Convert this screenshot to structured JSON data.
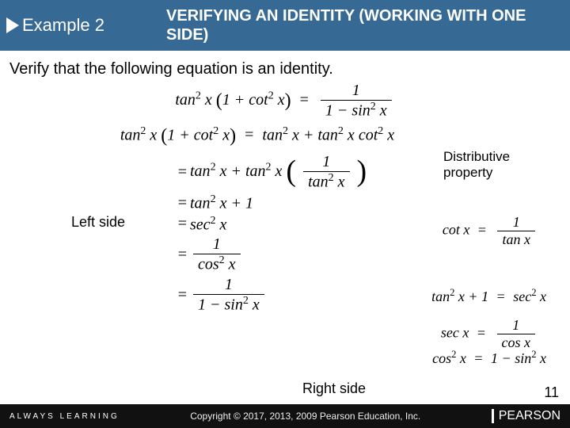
{
  "header": {
    "example_label": "Example 2",
    "title": "VERIFYING AN IDENTITY (WORKING WITH ONE SIDE)"
  },
  "instruction": "Verify that the following equation is an identity.",
  "equation_main": {
    "lhs_a": "tan",
    "lhs_b": "x",
    "lhs_c": "1",
    "lhs_d": "cot",
    "lhs_e": "x",
    "rhs_num": "1",
    "rhs_den_a": "1",
    "rhs_den_b": "sin",
    "rhs_den_c": "x"
  },
  "labels": {
    "left_side": "Left side",
    "right_side": "Right side",
    "distributive": "Distributive property"
  },
  "steps": {
    "s1": {
      "a": "tan",
      "b": "x",
      "c": "1",
      "d": "cot",
      "e": "x",
      "f": "tan",
      "g": "x",
      "h": "tan",
      "i": "x",
      "j": "cot",
      "k": "x"
    },
    "s2": {
      "a": "tan",
      "b": "x",
      "c": "tan",
      "d": "x",
      "num": "1",
      "den_a": "tan",
      "den_b": "x"
    },
    "s3": {
      "a": "tan",
      "b": "x",
      "c": "1"
    },
    "s4": {
      "a": "sec",
      "b": "x"
    },
    "s5": {
      "num": "1",
      "den_a": "cos",
      "den_b": "x"
    },
    "s6": {
      "num": "1",
      "den_a": "1",
      "den_b": "sin",
      "den_c": "x"
    }
  },
  "identities": {
    "i1": {
      "a": "cot",
      "b": "x",
      "num": "1",
      "den_a": "tan",
      "den_b": "x"
    },
    "i2": {
      "a": "tan",
      "b": "x",
      "c": "1",
      "d": "sec",
      "e": "x"
    },
    "i3": {
      "a": "sec",
      "b": "x",
      "num": "1",
      "den_a": "cos",
      "den_b": "x"
    },
    "i4": {
      "a": "cos",
      "b": "x",
      "c": "1",
      "d": "sin",
      "e": "x"
    }
  },
  "footer": {
    "always": "ALWAYS LEARNING",
    "copyright": "Copyright © 2017, 2013, 2009 Pearson Education, Inc.",
    "brand": "PEARSON",
    "page": "11"
  }
}
